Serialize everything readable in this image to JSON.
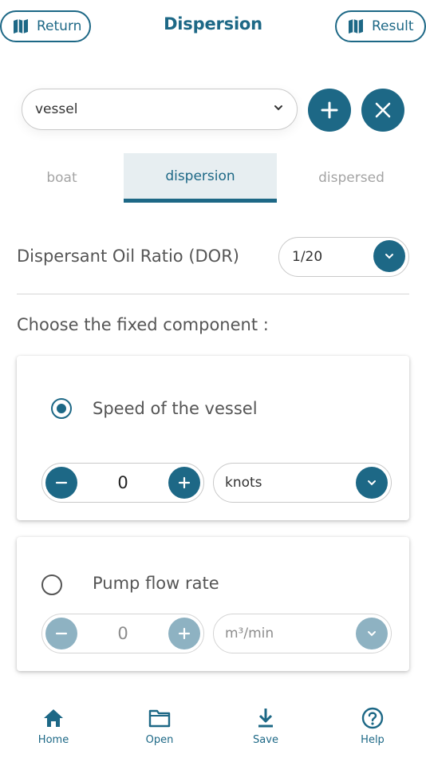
{
  "header": {
    "title": "Dispersion",
    "return_label": "Return",
    "result_label": "Result"
  },
  "vessel_select": {
    "value": "vessel"
  },
  "tabs": [
    {
      "label": "boat",
      "active": false
    },
    {
      "label": "dispersion",
      "active": true
    },
    {
      "label": "dispersed",
      "active": false
    }
  ],
  "dor": {
    "label": "Dispersant Oil Ratio (DOR)",
    "value": "1/20"
  },
  "fixed_component": {
    "heading": "Choose the fixed component :",
    "options": [
      {
        "label": "Speed of the vessel",
        "selected": true,
        "value": "0",
        "unit": "knots"
      },
      {
        "label": "Pump flow rate",
        "selected": false,
        "value": "0",
        "unit": "m³/min"
      }
    ]
  },
  "bottom_nav": [
    {
      "label": "Home",
      "icon": "home-icon"
    },
    {
      "label": "Open",
      "icon": "folder-icon"
    },
    {
      "label": "Save",
      "icon": "download-icon"
    },
    {
      "label": "Help",
      "icon": "help-icon"
    }
  ],
  "colors": {
    "accent": "#1d6886",
    "accent_disabled": "#8eb2c2",
    "tab_active_bg": "#e7eef1"
  }
}
